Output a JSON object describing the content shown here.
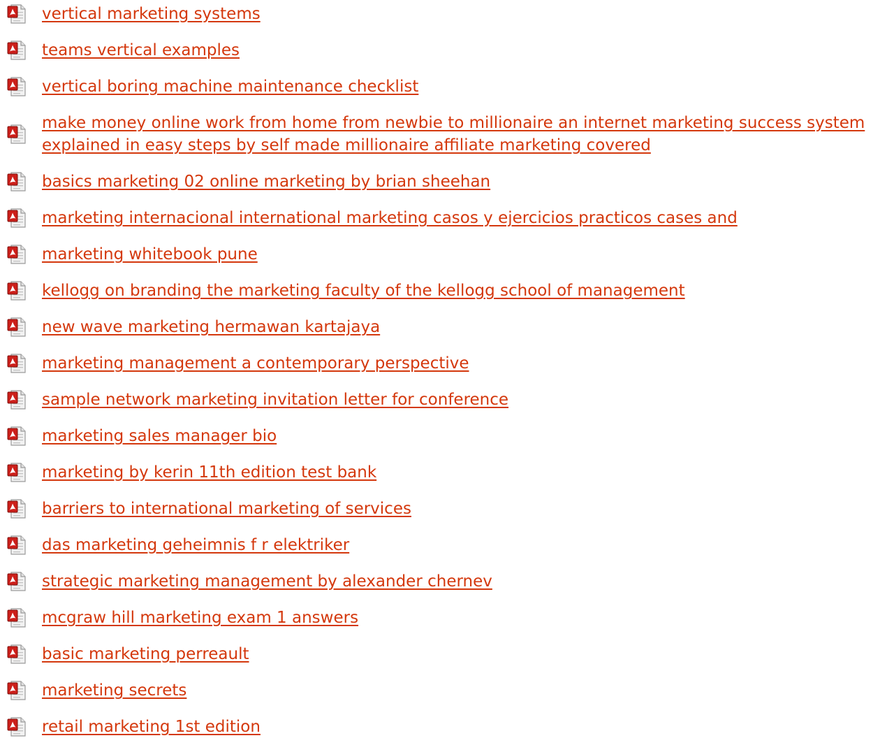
{
  "links": [
    {
      "text": "vertical marketing systems",
      "icon": "pdf-icon"
    },
    {
      "text": "teams vertical examples",
      "icon": "pdf-icon"
    },
    {
      "text": "vertical boring machine maintenance checklist",
      "icon": "pdf-icon"
    },
    {
      "text": "make money online work from home from newbie to millionaire an internet marketing success system explained in easy steps by self made millionaire affiliate marketing covered",
      "icon": "pdf-icon"
    },
    {
      "text": "basics marketing 02 online marketing by brian sheehan",
      "icon": "pdf-icon"
    },
    {
      "text": "marketing internacional international marketing casos y ejercicios practicos cases and",
      "icon": "pdf-icon"
    },
    {
      "text": "marketing whitebook pune",
      "icon": "pdf-icon"
    },
    {
      "text": "kellogg on branding the marketing faculty of the kellogg school of management",
      "icon": "pdf-icon"
    },
    {
      "text": "new wave marketing hermawan kartajaya",
      "icon": "pdf-icon"
    },
    {
      "text": "marketing management a contemporary perspective",
      "icon": "pdf-icon"
    },
    {
      "text": "sample network marketing invitation letter for conference",
      "icon": "pdf-icon"
    },
    {
      "text": "marketing sales manager bio",
      "icon": "pdf-icon"
    },
    {
      "text": "marketing by kerin 11th edition test bank",
      "icon": "pdf-icon"
    },
    {
      "text": "barriers to international marketing of services",
      "icon": "pdf-icon"
    },
    {
      "text": "das marketing geheimnis f r elektriker",
      "icon": "pdf-icon"
    },
    {
      "text": "strategic marketing management by alexander chernev",
      "icon": "pdf-icon"
    },
    {
      "text": "mcgraw hill marketing exam 1 answers",
      "icon": "pdf-icon"
    },
    {
      "text": "basic marketing perreault",
      "icon": "pdf-icon"
    },
    {
      "text": "marketing secrets",
      "icon": "pdf-icon"
    },
    {
      "text": "retail marketing 1st edition",
      "icon": "pdf-icon"
    }
  ],
  "colors": {
    "link": "#d4380d",
    "icon_red": "#cc1f1a",
    "icon_page": "#f4f4f4"
  }
}
